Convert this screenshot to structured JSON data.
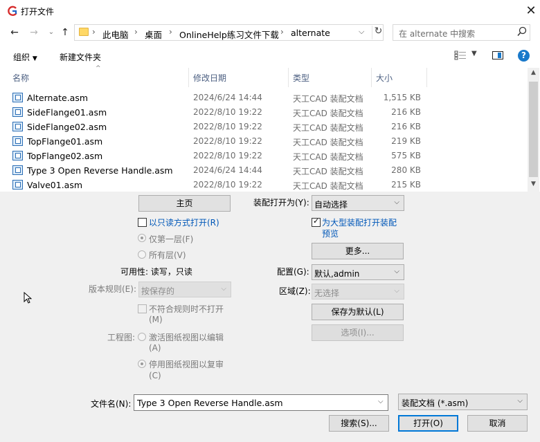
{
  "window": {
    "title": "打开文件"
  },
  "address": {
    "crumbs": [
      "此电脑",
      "桌面",
      "OnlineHelp练习文件下载",
      "alternate"
    ],
    "search_placeholder": "在 alternate 中搜索"
  },
  "toolbar": {
    "organize": "组织",
    "new_folder": "新建文件夹"
  },
  "columns": {
    "name": "名称",
    "modified": "修改日期",
    "type": "类型",
    "size": "大小"
  },
  "files": [
    {
      "name": "Alternate.asm",
      "modified": "2024/6/24 14:44",
      "type": "天工CAD 装配文档",
      "size": "1,515 KB"
    },
    {
      "name": "SideFlange01.asm",
      "modified": "2022/8/10 19:22",
      "type": "天工CAD 装配文档",
      "size": "216 KB"
    },
    {
      "name": "SideFlange02.asm",
      "modified": "2022/8/10 19:22",
      "type": "天工CAD 装配文档",
      "size": "216 KB"
    },
    {
      "name": "TopFlange01.asm",
      "modified": "2022/8/10 19:22",
      "type": "天工CAD 装配文档",
      "size": "219 KB"
    },
    {
      "name": "TopFlange02.asm",
      "modified": "2022/8/10 19:22",
      "type": "天工CAD 装配文档",
      "size": "575 KB"
    },
    {
      "name": "Type 3 Open Reverse Handle.asm",
      "modified": "2024/6/24 14:44",
      "type": "天工CAD 装配文档",
      "size": "280 KB"
    },
    {
      "name": "Valve01.asm",
      "modified": "2022/8/10 19:22",
      "type": "天工CAD 装配文档",
      "size": "215 KB"
    }
  ],
  "options": {
    "home_button": "主页",
    "readonly_label": "以只读方式打开(R)",
    "first_level_label": "仅第一层(F)",
    "all_levels_label": "所有层(V)",
    "availability": "可用性: 读写，只读",
    "version_rule_label": "版本规则(E):",
    "version_rule_value": "按保存的",
    "no_match_label_1": "不符合规则时不打开",
    "no_match_label_2": "(M)",
    "drawing_label": "工程图:",
    "activate_label_1": "激活图纸视图以编辑",
    "activate_label_2": "(A)",
    "deactivate_label_1": "停用图纸视图以复审",
    "deactivate_label_2": "(C)",
    "assembly_open_as_label": "装配打开为(Y):",
    "assembly_open_as_value": "自动选择",
    "large_preview_label_1": "为大型装配打开装配",
    "large_preview_label_2": "预览",
    "more_button": "更多...",
    "config_label": "配置(G):",
    "config_value": "默认,admin",
    "zone_label": "区域(Z):",
    "zone_value": "无选择",
    "save_default_button": "保存为默认(L)",
    "options_button": "选项(I)..."
  },
  "footer": {
    "filename_label": "文件名(N):",
    "filename_value": "Type 3 Open Reverse Handle.asm",
    "filetype_value": "装配文档 (*.asm)",
    "search_button": "搜索(S)...",
    "open_button": "打开(O)",
    "cancel_button": "取消"
  }
}
